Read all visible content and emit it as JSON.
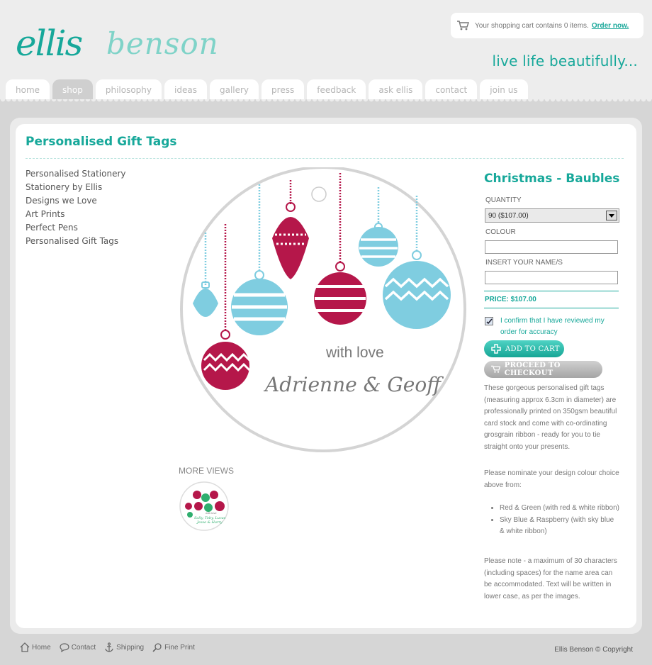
{
  "site": {
    "logo_text": "ellis benson",
    "tagline": "live life beautifully..."
  },
  "cart": {
    "text": "Your shopping cart contains 0 items.",
    "link": "Order now."
  },
  "nav": {
    "tabs": [
      {
        "label": "home"
      },
      {
        "label": "shop"
      },
      {
        "label": "philosophy"
      },
      {
        "label": "ideas"
      },
      {
        "label": "gallery"
      },
      {
        "label": "press"
      },
      {
        "label": "feedback"
      },
      {
        "label": "ask ellis"
      },
      {
        "label": "contact"
      },
      {
        "label": "join us"
      }
    ],
    "active": "shop"
  },
  "page": {
    "title": "Personalised Gift Tags"
  },
  "sidebar": {
    "items": [
      {
        "label": "Personalised Stationery"
      },
      {
        "label": "Stationery by Ellis"
      },
      {
        "label": "Designs we Love"
      },
      {
        "label": "Art Prints"
      },
      {
        "label": "Perfect Pens"
      },
      {
        "label": "Personalised Gift Tags"
      }
    ]
  },
  "product": {
    "image_text_1": "with love",
    "image_text_2": "Adrienne & Geoff",
    "more_views_label": "MORE VIEWS",
    "thumb_text_1": "with love",
    "thumb_text_2": "Sally, Toby, Lucas",
    "thumb_text_3": "Jesse & Harry",
    "name": "Christmas - Baubles",
    "quantity_label": "QUANTITY",
    "quantity_value": "90 ($107.00)",
    "colour_label": "COLOUR",
    "colour_value": "",
    "names_label": "INSERT YOUR NAME/S",
    "names_value": "",
    "price": "PRICE: $107.00",
    "confirm_text": "I confirm that I have reviewed my order for accuracy",
    "add_to_cart": "ADD TO CART",
    "checkout": "PROCEED TO CHECKOUT",
    "description_1": "These gorgeous personalised gift tags (measuring approx 6.3cm in diameter) are professionally printed on 350gsm beautiful card stock and come with co-ordinating grosgrain ribbon - ready for you to tie straight onto your presents.",
    "description_2": "Please nominate your design colour choice above from:",
    "options": [
      {
        "label": "Red & Green (with red & white ribbon)"
      },
      {
        "label": "Sky Blue & Raspberry (with sky blue & white ribbon)"
      }
    ],
    "description_3": "Please note - a maximum of 30 characters (including spaces) for the name area can be accommodated. Text will be written in lower case, as per the images."
  },
  "footer": {
    "links": [
      {
        "label": "Home",
        "icon": "home-icon"
      },
      {
        "label": "Contact",
        "icon": "speech-bubble-icon"
      },
      {
        "label": "Shipping",
        "icon": "anchor-icon"
      },
      {
        "label": "Fine Print",
        "icon": "magnifier-icon"
      }
    ],
    "copyright": "Ellis Benson © Copyright"
  },
  "colors": {
    "brand_teal": "#17a89a",
    "raspberry": "#b5174a",
    "sky_blue": "#7fcde0"
  }
}
